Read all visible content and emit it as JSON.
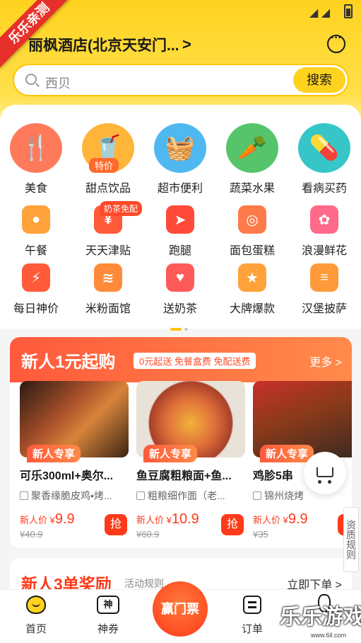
{
  "watermark_ribbon": "乐乐亲测",
  "header": {
    "location": "丽枫酒店(北京天安门...",
    "arrow": ">"
  },
  "search": {
    "placeholder": "西贝",
    "button": "搜索"
  },
  "categories_main": [
    {
      "label": "美食",
      "icon": "fork-spoon-icon",
      "color": "#ff7a5a",
      "glyph": "🍴"
    },
    {
      "label": "甜点饮品",
      "icon": "drink-cup-icon",
      "color": "#ffb43a",
      "glyph": "🥤",
      "tag": "特价"
    },
    {
      "label": "超市便利",
      "icon": "shopping-basket-icon",
      "color": "#4fb8f0",
      "glyph": "🧺"
    },
    {
      "label": "蔬菜水果",
      "icon": "carrot-icon",
      "color": "#55c46a",
      "glyph": "🥕"
    },
    {
      "label": "看病买药",
      "icon": "medical-kit-icon",
      "color": "#36c6c8",
      "glyph": "💊"
    }
  ],
  "categories_row2": [
    {
      "label": "午餐",
      "icon": "rice-bowl-icon",
      "color": "#ffa23a",
      "glyph": "●"
    },
    {
      "label": "天天津贴",
      "icon": "coupon-icon",
      "color": "#ff5a3a",
      "glyph": "¥"
    },
    {
      "label": "跑腿",
      "icon": "runner-icon",
      "color": "#ff4a3a",
      "glyph": "➤"
    },
    {
      "label": "面包蛋糕",
      "icon": "donut-icon",
      "color": "#ff7a4a",
      "glyph": "◎"
    },
    {
      "label": "浪漫鲜花",
      "icon": "flower-icon",
      "color": "#ff6a8a",
      "glyph": "✿"
    }
  ],
  "categories_row3": [
    {
      "label": "每日神价",
      "icon": "lightning-icon",
      "color": "#ff5a3a",
      "glyph": "⚡"
    },
    {
      "label": "米粉面馆",
      "icon": "noodle-bowl-icon",
      "color": "#ff8a3a",
      "glyph": "≋"
    },
    {
      "label": "送奶茶",
      "icon": "gift-icon",
      "color": "#ff5a5a",
      "glyph": "♥"
    },
    {
      "label": "大牌爆款",
      "icon": "star-badge-icon",
      "color": "#ffa23a",
      "glyph": "★"
    },
    {
      "label": "汉堡披萨",
      "icon": "burger-icon",
      "color": "#ff9a3a",
      "glyph": "≡"
    }
  ],
  "row2_badge": "奶茶免配",
  "new_user": {
    "title": "新人1元起购",
    "tag": "0元起送 免餐盒费 免配送费",
    "more": "更多 >",
    "products": [
      {
        "name": "可乐300ml+奥尔...",
        "shop": "聚香缘脆皮鸡•烤...",
        "label": "新人专享",
        "price_label": "新人价 ¥",
        "price": "9.9",
        "orig": "¥40.9",
        "grab": "抢"
      },
      {
        "name": "鱼豆腐粗粮面+鱼...",
        "shop": "粗粮细作面（老...",
        "label": "新人专享",
        "price_label": "新人价 ¥",
        "price": "10.9",
        "orig": "¥60.9",
        "grab": "抢"
      },
      {
        "name": "鸡胗5串",
        "shop": "锦州烧烤",
        "label": "新人专享",
        "price_label": "新人价 ¥",
        "price": "9.9",
        "orig": "¥35",
        "grab": "抢"
      }
    ]
  },
  "side_tab": "资质规则",
  "new_user3": {
    "title": "新人3单奖励",
    "rule": "活动规则",
    "go": "立即下单 >"
  },
  "nav": {
    "home": "首页",
    "coupon": "神券",
    "center": "赢门票",
    "orders": "订单",
    "mine": ""
  },
  "site_watermark": "乐乐游戏",
  "site_url": "www.6ll.com"
}
